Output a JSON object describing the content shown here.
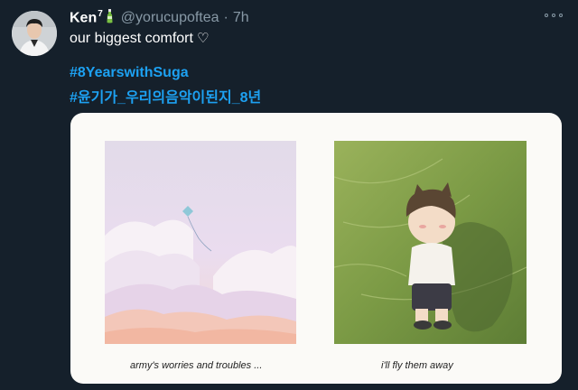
{
  "tweet": {
    "display_name": "Ken",
    "name_superscript": "7",
    "handle": "@yorucupoftea",
    "separator": "·",
    "time": "7h",
    "text": "our biggest comfort",
    "heart": "♡",
    "hashtags": [
      "#8YearswithSuga",
      "#윤기가_우리의음악이된지_8년"
    ]
  },
  "media": {
    "captions": [
      "army's worries and troubles ...",
      "i'll fly them away"
    ]
  },
  "colors": {
    "background": "#15202b",
    "link": "#1da1f2",
    "secondary_text": "#8899a6"
  },
  "icons": [
    "more-options-icon",
    "bottle-emoji-icon",
    "kite-icon"
  ]
}
